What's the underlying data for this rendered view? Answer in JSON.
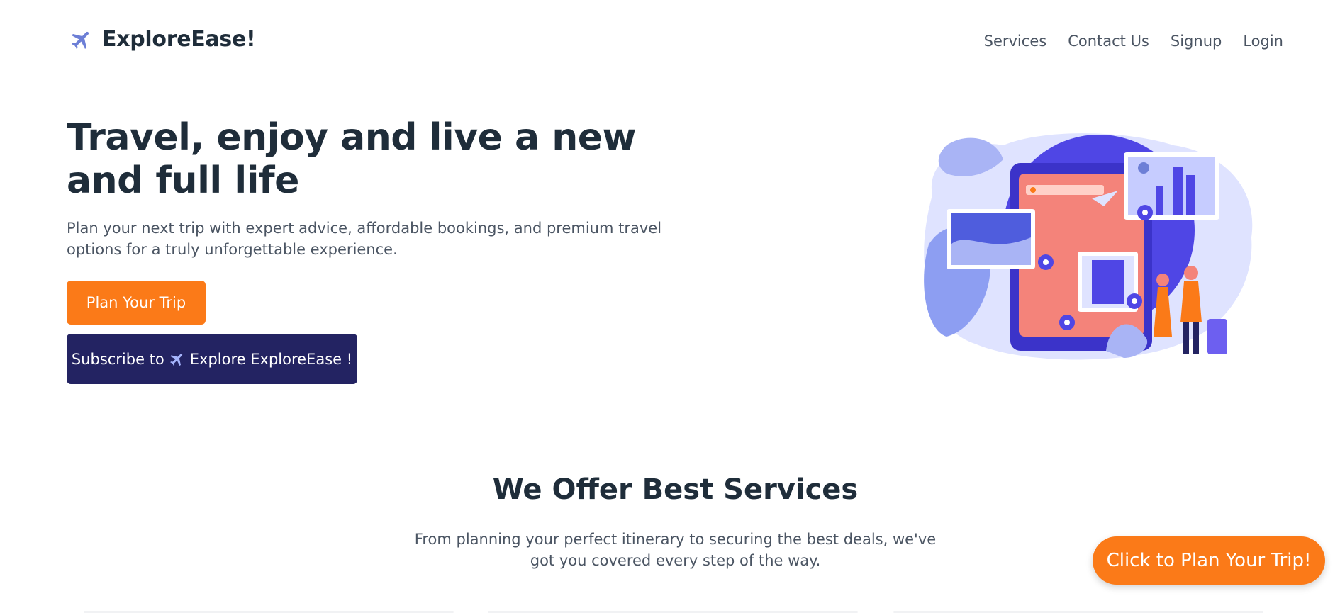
{
  "brand": {
    "name": "ExploreEase!",
    "icon": "airplane-icon"
  },
  "nav": {
    "items": [
      "Services",
      "Contact Us",
      "Signup",
      "Login"
    ]
  },
  "hero": {
    "title": "Travel, enjoy and live a new and full life",
    "subtitle": "Plan your next trip with expert advice, affordable bookings, and premium travel options for a truly unforgettable experience.",
    "primary_button": "Plan Your Trip",
    "subscribe_prefix": "Subscribe to",
    "subscribe_suffix": "Explore ExploreEase !"
  },
  "services": {
    "title": "We Offer Best Services",
    "subtitle": "From planning your perfect itinerary to securing the best deals, we've got you covered every step of the way."
  },
  "floating_button": "Click to Plan Your Trip!",
  "colors": {
    "accent": "#fb7a18",
    "navy": "#232362",
    "text": "#1f2d3a",
    "muted": "#4b5563",
    "illustration_blue": "#4f46e5"
  }
}
